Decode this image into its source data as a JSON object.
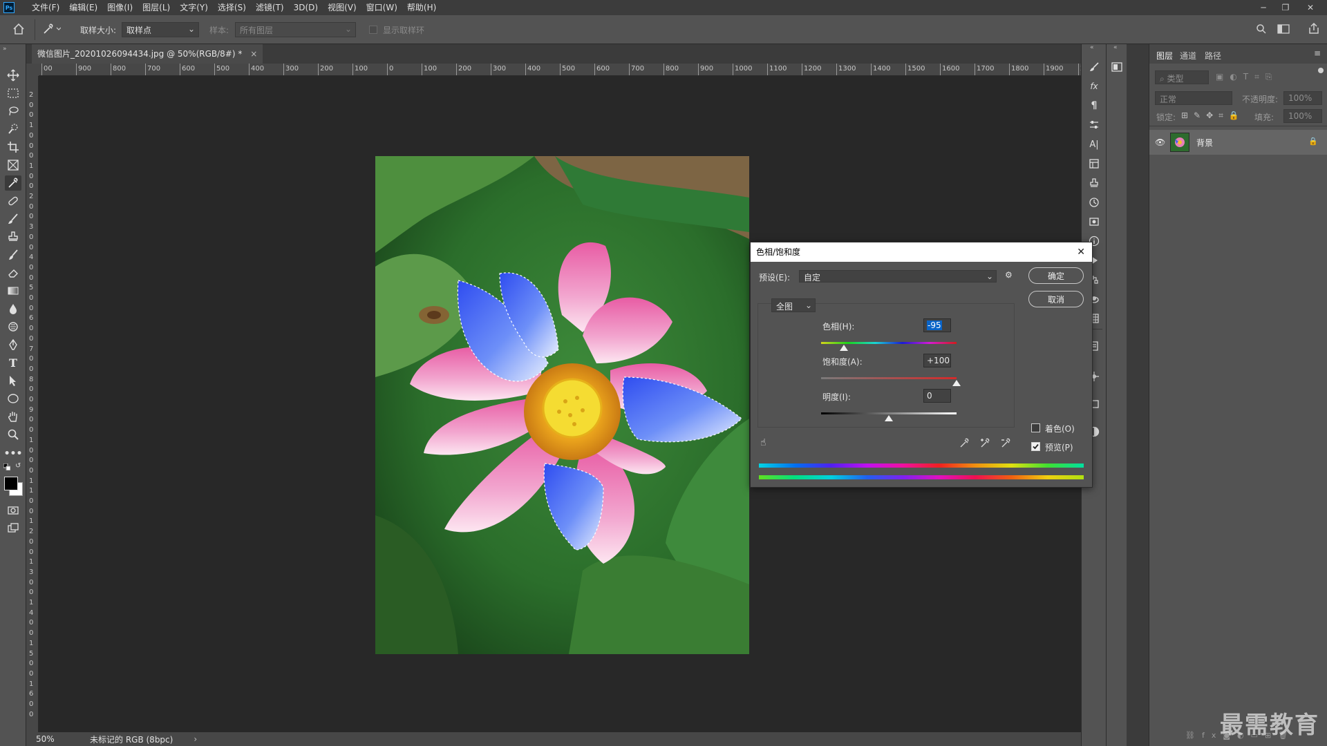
{
  "app": {
    "logo": "Ps"
  },
  "menu": [
    "文件(F)",
    "编辑(E)",
    "图像(I)",
    "图层(L)",
    "文字(Y)",
    "选择(S)",
    "滤镜(T)",
    "3D(D)",
    "视图(V)",
    "窗口(W)",
    "帮助(H)"
  ],
  "options": {
    "sample_size_label": "取样大小:",
    "sample_size_value": "取样点",
    "sample_label": "样本:",
    "sample_value": "所有图层",
    "show_ring_label": "显示取样环"
  },
  "document": {
    "tab_title": "微信图片_20201026094434.jpg @ 50%(RGB/8#) *",
    "close": "×"
  },
  "ruler": {
    "top_ticks": [
      "00",
      "900",
      "800",
      "700",
      "600",
      "500",
      "400",
      "300",
      "200",
      "100",
      "0",
      "100",
      "200",
      "300",
      "400",
      "500",
      "600",
      "700",
      "800",
      "900",
      "1000",
      "1100",
      "1200",
      "1300",
      "1400",
      "1500",
      "1600",
      "1700",
      "1800",
      "1900",
      "200"
    ],
    "left_ticks": [
      "2",
      "0",
      "0",
      "1",
      "0",
      "0",
      "0",
      "1",
      "0",
      "0",
      "2",
      "0",
      "0",
      "3",
      "0",
      "0",
      "4",
      "0",
      "0",
      "5",
      "0",
      "0",
      "6",
      "0",
      "0",
      "7",
      "0",
      "0",
      "8",
      "0",
      "0",
      "9",
      "0",
      "0",
      "1",
      "0",
      "0",
      "0",
      "1",
      "1",
      "0",
      "0",
      "1",
      "2",
      "0",
      "0",
      "1",
      "3",
      "0",
      "0",
      "1",
      "4",
      "0",
      "0",
      "1",
      "5",
      "0",
      "0",
      "1",
      "6",
      "0",
      "0"
    ]
  },
  "status": {
    "zoom": "50%",
    "profile": "未标记的 RGB (8bpc)",
    "arrow": "›"
  },
  "layers_panel": {
    "tabs": [
      "图层",
      "通道",
      "路径"
    ],
    "filter_placeholder": "类型",
    "blend_mode": "正常",
    "opacity_label": "不透明度:",
    "opacity_value": "100%",
    "lock_label": "锁定:",
    "fill_label": "填充:",
    "fill_value": "100%",
    "layer_name": "背景"
  },
  "dialog": {
    "title": "色相/饱和度",
    "preset_label": "预设(E):",
    "preset_value": "自定",
    "ok": "确定",
    "cancel": "取消",
    "channel": "全图",
    "hue_label": "色相(H):",
    "hue_value": "-95",
    "hue_position": 0.17,
    "saturation_label": "饱和度(A):",
    "saturation_value": "+100",
    "saturation_position": 1.0,
    "lightness_label": "明度(I):",
    "lightness_value": "0",
    "lightness_position": 0.5,
    "colorize_label": "着色(O)",
    "colorize_checked": false,
    "preview_label": "预览(P)",
    "preview_checked": true
  },
  "watermark": "最需教育",
  "colors": {
    "accent": "#31a8ff",
    "panel": "#535353",
    "dark": "#282828",
    "selection": "#0a64c8"
  }
}
